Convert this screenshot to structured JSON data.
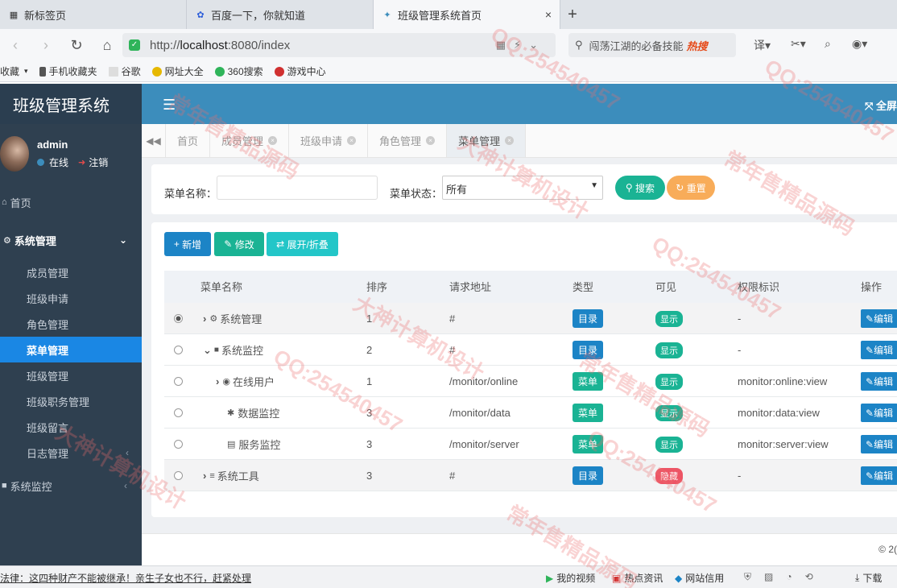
{
  "browser": {
    "tabs": [
      {
        "title": "新标签页"
      },
      {
        "title": "百度一下，你就知道"
      },
      {
        "title": "班级管理系统首页"
      }
    ],
    "url_prefix": "http://",
    "url_host": "localhost",
    "url_rest": ":8080/index",
    "search_text": "闯荡江湖的必备技能",
    "search_hot": "热搜",
    "bookmarks": [
      {
        "label": "收藏",
        "color": "#999"
      },
      {
        "label": "手机收藏夹",
        "color": "#555"
      },
      {
        "label": "谷歌",
        "color": "#888"
      },
      {
        "label": "网址大全",
        "color": "#e6b800"
      },
      {
        "label": "360搜索",
        "color": "#2fb45a"
      },
      {
        "label": "游戏中心",
        "color": "#d03030"
      }
    ]
  },
  "app": {
    "logo": "班级管理系统",
    "fullscreen": "全屏",
    "user": {
      "name": "admin",
      "status": "在线",
      "logout": "注销"
    },
    "menu": {
      "home": "首页",
      "system": "系统管理",
      "sub": [
        "成员管理",
        "班级申请",
        "角色管理",
        "菜单管理",
        "班级管理",
        "班级职务管理",
        "班级留言",
        "日志管理"
      ],
      "monitor": "系统监控"
    },
    "page_tabs": [
      "首页",
      "成员管理",
      "班级申请",
      "角色管理",
      "菜单管理"
    ],
    "search": {
      "name_label": "菜单名称：",
      "status_label": "菜单状态：",
      "status_value": "所有",
      "search_btn": "搜索",
      "reset_btn": "重置"
    },
    "toolbar": {
      "add": "新增",
      "edit": "修改",
      "toggle": "展开/折叠"
    },
    "table": {
      "headers": [
        "菜单名称",
        "排序",
        "请求地址",
        "类型",
        "可见",
        "权限标识",
        "操作"
      ],
      "rows": [
        {
          "name": "系统管理",
          "order": "1",
          "url": "#",
          "type": "目录",
          "visible": "显示",
          "perm": "-",
          "action": "编辑"
        },
        {
          "name": "系统监控",
          "order": "2",
          "url": "#",
          "type": "目录",
          "visible": "显示",
          "perm": "-",
          "action": "编辑"
        },
        {
          "name": "在线用户",
          "order": "1",
          "url": "/monitor/online",
          "type": "菜单",
          "visible": "显示",
          "perm": "monitor:online:view",
          "action": "编辑"
        },
        {
          "name": "数据监控",
          "order": "3",
          "url": "/monitor/data",
          "type": "菜单",
          "visible": "显示",
          "perm": "monitor:data:view",
          "action": "编辑"
        },
        {
          "name": "服务监控",
          "order": "3",
          "url": "/monitor/server",
          "type": "菜单",
          "visible": "显示",
          "perm": "monitor:server:view",
          "action": "编辑"
        },
        {
          "name": "系统工具",
          "order": "3",
          "url": "#",
          "type": "目录",
          "visible": "隐藏",
          "perm": "-",
          "action": "编辑"
        }
      ]
    },
    "copyright": "© 2("
  },
  "statusbar": {
    "news": "法律：这四种财产不能被继承！亲生子女也不行，赶紧处理",
    "items": [
      "我的视频",
      "热点资讯",
      "网站信用",
      "下载"
    ]
  },
  "watermarks": [
    "QQ:254540457",
    "常年售精品源码",
    "大神计算机设计",
    "QQ:254540457",
    "常年售精品源码",
    "大神计算机设计",
    "QQ:254540457",
    "常年售精品源码",
    "QQ:254540457",
    "大神计算机设计",
    "常年售精品源码",
    "QQ:254540457"
  ],
  "colors": {
    "sidebar": "#2f4050",
    "topnav": "#3c8dbc",
    "active": "#1a87e4",
    "green": "#1ab394",
    "blue": "#1c84c6",
    "red": "#ed5565"
  }
}
